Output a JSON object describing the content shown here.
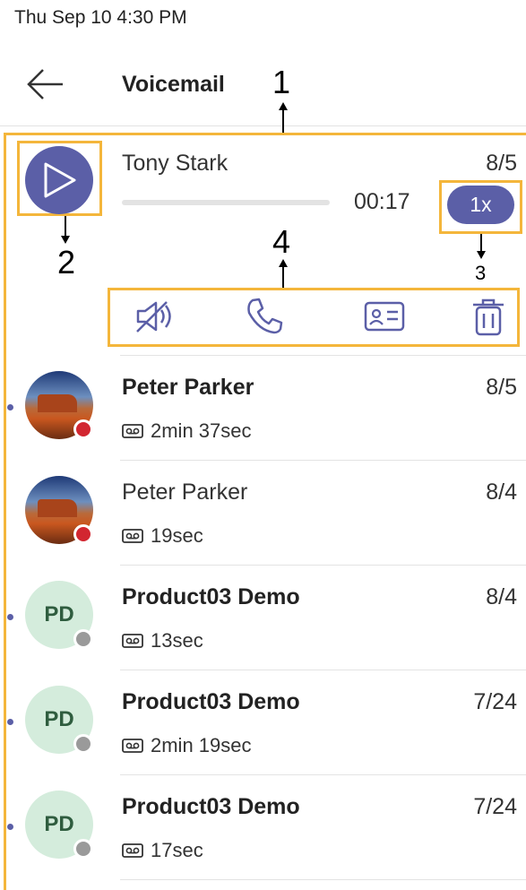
{
  "status_bar": {
    "datetime": "Thu Sep 10  4:30 PM"
  },
  "header": {
    "title": "Voicemail",
    "back_icon": "arrow-left-icon"
  },
  "annotations": {
    "a1": "1",
    "a2": "2",
    "a3": "3",
    "a4": "4"
  },
  "expanded": {
    "name": "Tony Stark",
    "date": "8/5",
    "time": "00:17",
    "speed": "1x",
    "progress": 0,
    "play_icon": "play-icon",
    "actions": [
      {
        "label": "mute",
        "icon": "speaker-mute-icon"
      },
      {
        "label": "call",
        "icon": "phone-icon"
      },
      {
        "label": "contact",
        "icon": "contact-card-icon"
      },
      {
        "label": "delete",
        "icon": "trash-icon"
      }
    ]
  },
  "items": [
    {
      "name": "Peter Parker",
      "date": "8/5",
      "duration": "2min 37sec",
      "unread": true,
      "avatar": "photo",
      "presence": "busy"
    },
    {
      "name": "Peter Parker",
      "date": "8/4",
      "duration": "19sec",
      "unread": false,
      "avatar": "photo",
      "presence": "busy"
    },
    {
      "name": "Product03 Demo",
      "date": "8/4",
      "duration": "13sec",
      "unread": true,
      "avatar": "PD",
      "presence": "offline"
    },
    {
      "name": "Product03 Demo",
      "date": "7/24",
      "duration": "2min 19sec",
      "unread": true,
      "avatar": "PD",
      "presence": "offline"
    },
    {
      "name": "Product03 Demo",
      "date": "7/24",
      "duration": "17sec",
      "unread": true,
      "avatar": "PD",
      "presence": "offline"
    }
  ],
  "colors": {
    "accent": "#5b5fa7",
    "highlight": "#f4b63b",
    "busy": "#d22630",
    "offline": "#9a9a9a"
  }
}
